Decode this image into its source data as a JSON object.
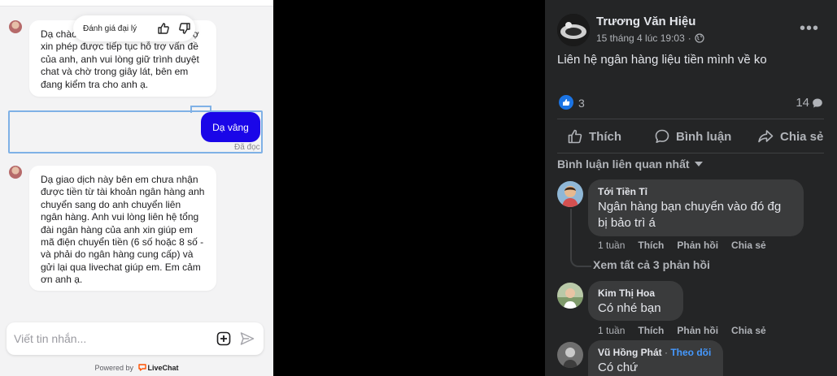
{
  "livechat": {
    "rating_prompt": "Đánh giá đại lý",
    "messages": [
      {
        "from": "agent",
        "text": "Dạ chào anh, em là nhân viên hỗ trợ xin phép được tiếp tục hỗ trợ vấn đề của anh, anh vui lòng giữ trình duyệt chat và chờ trong giây lát, bên em đang kiểm tra cho anh ạ."
      },
      {
        "from": "user",
        "text": "Dạ vâng",
        "status": "Đã đọc"
      },
      {
        "from": "agent",
        "text": "Dạ giao dịch này bên em chưa nhận được tiền từ tài khoản ngân hàng anh chuyển sang do anh chuyển liên ngân hàng. Anh vui lòng liên hệ tổng đài ngân hàng của anh xin giúp em mã điện chuyển tiền (6 số hoặc 8 số - và phải do ngân hàng cung cấp) và gửi lại qua livechat giúp em. Em cảm ơn anh ạ."
      }
    ],
    "input_placeholder": "Viết tin nhắn...",
    "powered_by": "Powered by",
    "brand": "LiveChat",
    "accent_color": "#1a06e8",
    "brand_color": "#ff5100"
  },
  "facebook": {
    "post": {
      "author": "Trương Văn Hiệu",
      "timestamp": "15 tháng 4 lúc 19:03",
      "text": "Liên hệ ngân hàng liệu tiền mình về ko",
      "reaction_count": "3",
      "comment_count": "14"
    },
    "actions": {
      "like": "Thích",
      "comment": "Bình luận",
      "share": "Chia sẻ"
    },
    "sort_label": "Bình luận liên quan nhất",
    "comments": [
      {
        "name": "Tới Tiền Tỉ",
        "text_line1": "Ngân hàng bạn chuyển vào đó đg",
        "text_line2": "bị bảo trì á",
        "time": "1 tuần",
        "like": "Thích",
        "reply": "Phản hồi",
        "share": "Chia sẻ",
        "see_replies": "Xem tất cả 3 phản hồi"
      },
      {
        "name": "Kim Thị Hoa",
        "text": "Có nhé bạn",
        "time": "1 tuần",
        "like": "Thích",
        "reply": "Phản hồi",
        "share": "Chia sẻ"
      },
      {
        "name": "Vũ Hồng Phát",
        "separator": " · ",
        "follow": "Theo dõi",
        "text": "Có chứ"
      }
    ],
    "like_color": "#1b74e4",
    "follow_color": "#4599ff"
  }
}
